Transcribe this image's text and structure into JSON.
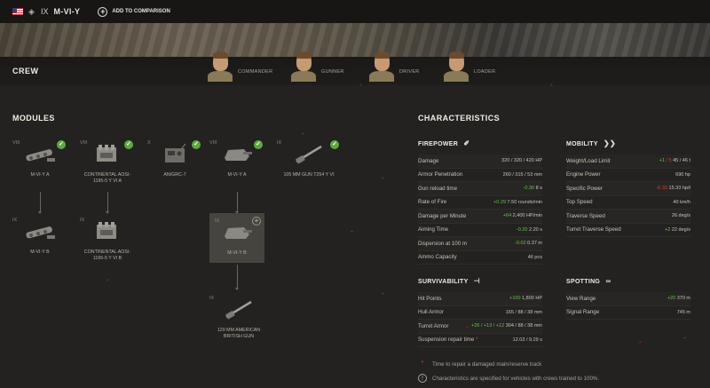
{
  "header": {
    "tier": "IX",
    "tank_name": "M-VI-Y",
    "add_comparison": "ADD TO COMPARISON",
    "flag_icon": "us-flag-icon",
    "class_icon": "heavy-tank-icon"
  },
  "crew": {
    "title": "CREW",
    "members": [
      {
        "role": "COMMANDER"
      },
      {
        "role": "GUNNER"
      },
      {
        "role": "DRIVER"
      },
      {
        "role": "LOADER"
      }
    ]
  },
  "modules": {
    "title": "MODULES",
    "items": [
      {
        "tier": "VIII",
        "name": "M-VI-Y A",
        "researched": true,
        "icon": "tracks-icon"
      },
      {
        "tier": "VIII",
        "name": "CONTINENTAL AOSI-1195-5 Y VI A",
        "researched": true,
        "icon": "engine-icon"
      },
      {
        "tier": "X",
        "name": "AN/GRC-7",
        "researched": true,
        "icon": "radio-icon"
      },
      {
        "tier": "VIII",
        "name": "M-VI-Y A",
        "researched": true,
        "icon": "turret-icon"
      },
      {
        "tier": "IX",
        "name": "105 MM GUN T254 Y VI",
        "researched": true,
        "icon": "gun-icon"
      },
      {
        "tier": "IX",
        "name": "M-VI-Y B",
        "researched": false,
        "icon": "tracks-icon"
      },
      {
        "tier": "IX",
        "name": "CONTINENTAL AOSI-1195-5 Y VI B",
        "researched": false,
        "icon": "engine-icon"
      },
      {
        "tier": "IX",
        "name": "M-VI-Y B",
        "researched": false,
        "selected": true,
        "icon": "turret-icon"
      },
      {
        "tier": "IX",
        "name": "120 MM AMERICAN BRITISH GUN",
        "researched": false,
        "icon": "gun-icon"
      }
    ]
  },
  "characteristics": {
    "title": "CHARACTERISTICS",
    "firepower": {
      "title": "FIREPOWER",
      "rows": [
        {
          "label": "Damage",
          "delta": "",
          "value": "320 / 320 / 420 HP"
        },
        {
          "label": "Armor Penetration",
          "delta": "",
          "value": "260 / 315 / 53 mm"
        },
        {
          "label": "Gun reload time",
          "delta": "-0.30",
          "value": "8 s",
          "delta_type": "pos"
        },
        {
          "label": "Rate of Fire",
          "delta": "+0.29",
          "value": "7.50 rounds/min",
          "delta_type": "pos"
        },
        {
          "label": "Damage per Minute",
          "delta": "+64",
          "value": "2,400 HP/min",
          "delta_type": "pos"
        },
        {
          "label": "Aiming Time",
          "delta": "-0.20",
          "value": "2.20 s",
          "delta_type": "pos"
        },
        {
          "label": "Dispersion at 100 m",
          "delta": "-0.02",
          "value": "0.37 m",
          "delta_type": "pos"
        },
        {
          "label": "Ammo Capacity",
          "delta": "",
          "value": "46 pcs"
        }
      ]
    },
    "mobility": {
      "title": "MOBILITY",
      "rows": [
        {
          "label": "Weight/Load Limit",
          "delta": "+1",
          "delta2": "/ 5",
          "value": "45 / 46 t",
          "delta_type": "pos",
          "delta2_type": "neg"
        },
        {
          "label": "Engine Power",
          "delta": "",
          "value": "690 hp"
        },
        {
          "label": "Specific Power",
          "delta": "-0.33",
          "value": "15.33 hp/t",
          "delta_type": "neg"
        },
        {
          "label": "Top Speed",
          "delta": "",
          "value": "40 km/h"
        },
        {
          "label": "Traverse Speed",
          "delta": "",
          "value": "26 deg/s"
        },
        {
          "label": "Turret Traverse Speed",
          "delta": "+2",
          "value": "22 deg/s",
          "delta_type": "pos"
        }
      ]
    },
    "survivability": {
      "title": "SURVIVABILITY",
      "rows": [
        {
          "label": "Hit Points",
          "delta": "+100",
          "value": "1,800 HP",
          "delta_type": "pos"
        },
        {
          "label": "Hull Armor",
          "delta": "",
          "value": "165 / 88 / 38 mm"
        },
        {
          "label": "Turret Armor",
          "delta": "+26 / +13 / +12",
          "value": "304 / 88 / 38 mm",
          "delta_type": "pos"
        },
        {
          "label": "Suspension repair time",
          "star": "*",
          "delta": "",
          "value": "12.03 / 9.29 s"
        }
      ]
    },
    "spotting": {
      "title": "SPOTTING",
      "rows": [
        {
          "label": "View Range",
          "delta": "+20",
          "value": "370 m",
          "delta_type": "pos"
        },
        {
          "label": "Signal Range",
          "delta": "",
          "value": "745 m"
        }
      ]
    },
    "footnotes": {
      "repair": "Time to repair a damaged main/reserve track",
      "crew_note": "Characteristics are specified for vehicles with crews trained to 100%."
    }
  },
  "colors": {
    "positive": "#6cc04a",
    "negative": "#d9432f",
    "check": "#5ca93f",
    "background": "#232220"
  }
}
